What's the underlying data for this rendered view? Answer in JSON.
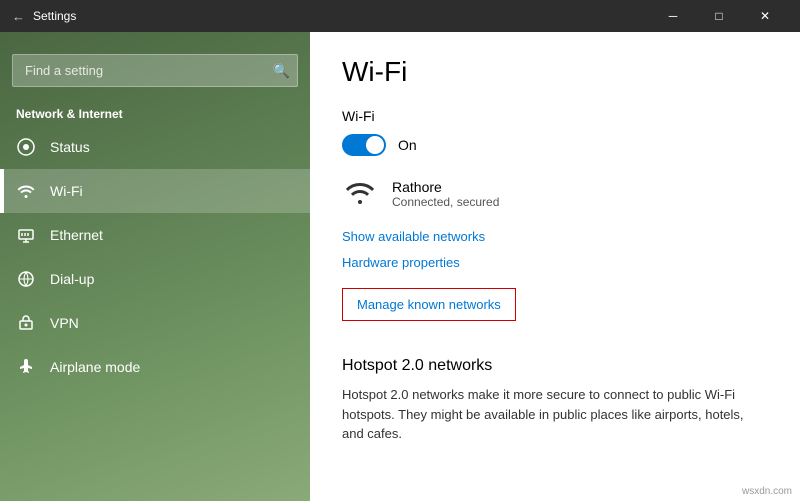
{
  "titleBar": {
    "back_icon": "←",
    "title": "Settings",
    "minimize": "─",
    "maximize": "□",
    "close": "✕"
  },
  "sidebar": {
    "search_placeholder": "Find a setting",
    "search_icon": "🔍",
    "section_label": "Network & Internet",
    "nav_items": [
      {
        "id": "status",
        "label": "Status",
        "icon": "⊙"
      },
      {
        "id": "wifi",
        "label": "Wi-Fi",
        "icon": "wifi",
        "active": true
      },
      {
        "id": "ethernet",
        "label": "Ethernet",
        "icon": "ethernet"
      },
      {
        "id": "dialup",
        "label": "Dial-up",
        "icon": "dialup"
      },
      {
        "id": "vpn",
        "label": "VPN",
        "icon": "vpn"
      },
      {
        "id": "airplane",
        "label": "Airplane mode",
        "icon": "airplane"
      }
    ]
  },
  "main": {
    "page_title": "Wi-Fi",
    "wifi_section_label": "Wi-Fi",
    "toggle_state": "On",
    "network_name": "Rathore",
    "network_status": "Connected, secured",
    "show_networks_link": "Show available networks",
    "hardware_properties_link": "Hardware properties",
    "manage_networks_label": "Manage known networks",
    "hotspot_title": "Hotspot 2.0 networks",
    "hotspot_desc": "Hotspot 2.0 networks make it more secure to connect to public Wi-Fi hotspots. They might be available in public places like airports, hotels, and cafes."
  },
  "watermark": "wsxdn.com"
}
